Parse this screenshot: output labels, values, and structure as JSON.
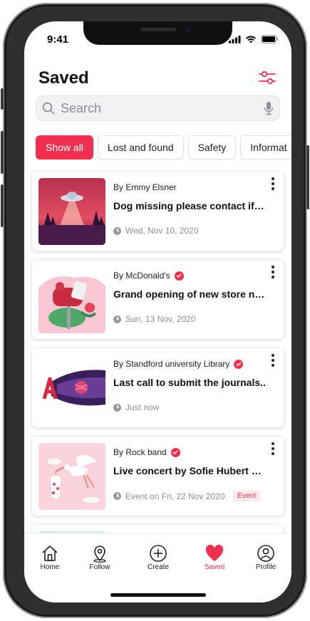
{
  "status": {
    "time": "9:41"
  },
  "header": {
    "title": "Saved",
    "filter_icon": "sliders-icon"
  },
  "search": {
    "placeholder": "Search",
    "mic_icon": "microphone-icon"
  },
  "chips": [
    {
      "label": "Show all",
      "active": true
    },
    {
      "label": "Lost and found",
      "active": false
    },
    {
      "label": "Safety",
      "active": false
    },
    {
      "label": "Informat",
      "active": false
    }
  ],
  "cards": [
    {
      "author": "By Emmy Elsner",
      "verified": false,
      "headline": "Dog missing please contact if f...",
      "meta": "Wed, Nov 10, 2020",
      "badge": ""
    },
    {
      "author": "By McDonald's",
      "verified": true,
      "headline": "Grand opening of new store near...",
      "meta": "Sun, 13 Nov, 2020",
      "badge": ""
    },
    {
      "author": "By Standford university Library",
      "verified": true,
      "headline": "Last call to submit the journals..",
      "meta": "Just now",
      "badge": ""
    },
    {
      "author": "By Rock band",
      "verified": true,
      "headline": "Live concert by Sofie Hubert at ...",
      "meta": "Event on Fri, 22 Nov 2020",
      "badge": "Event"
    }
  ],
  "tabs": [
    {
      "label": "Home",
      "icon": "home-icon"
    },
    {
      "label": "Follow",
      "icon": "location-pin-icon"
    },
    {
      "label": "Create",
      "icon": "plus-circle-icon"
    },
    {
      "label": "Saved",
      "icon": "heart-icon",
      "active": true
    },
    {
      "label": "Profile",
      "icon": "user-icon"
    }
  ],
  "colors": {
    "accent": "#f0304f",
    "muted": "#8e8e93"
  }
}
